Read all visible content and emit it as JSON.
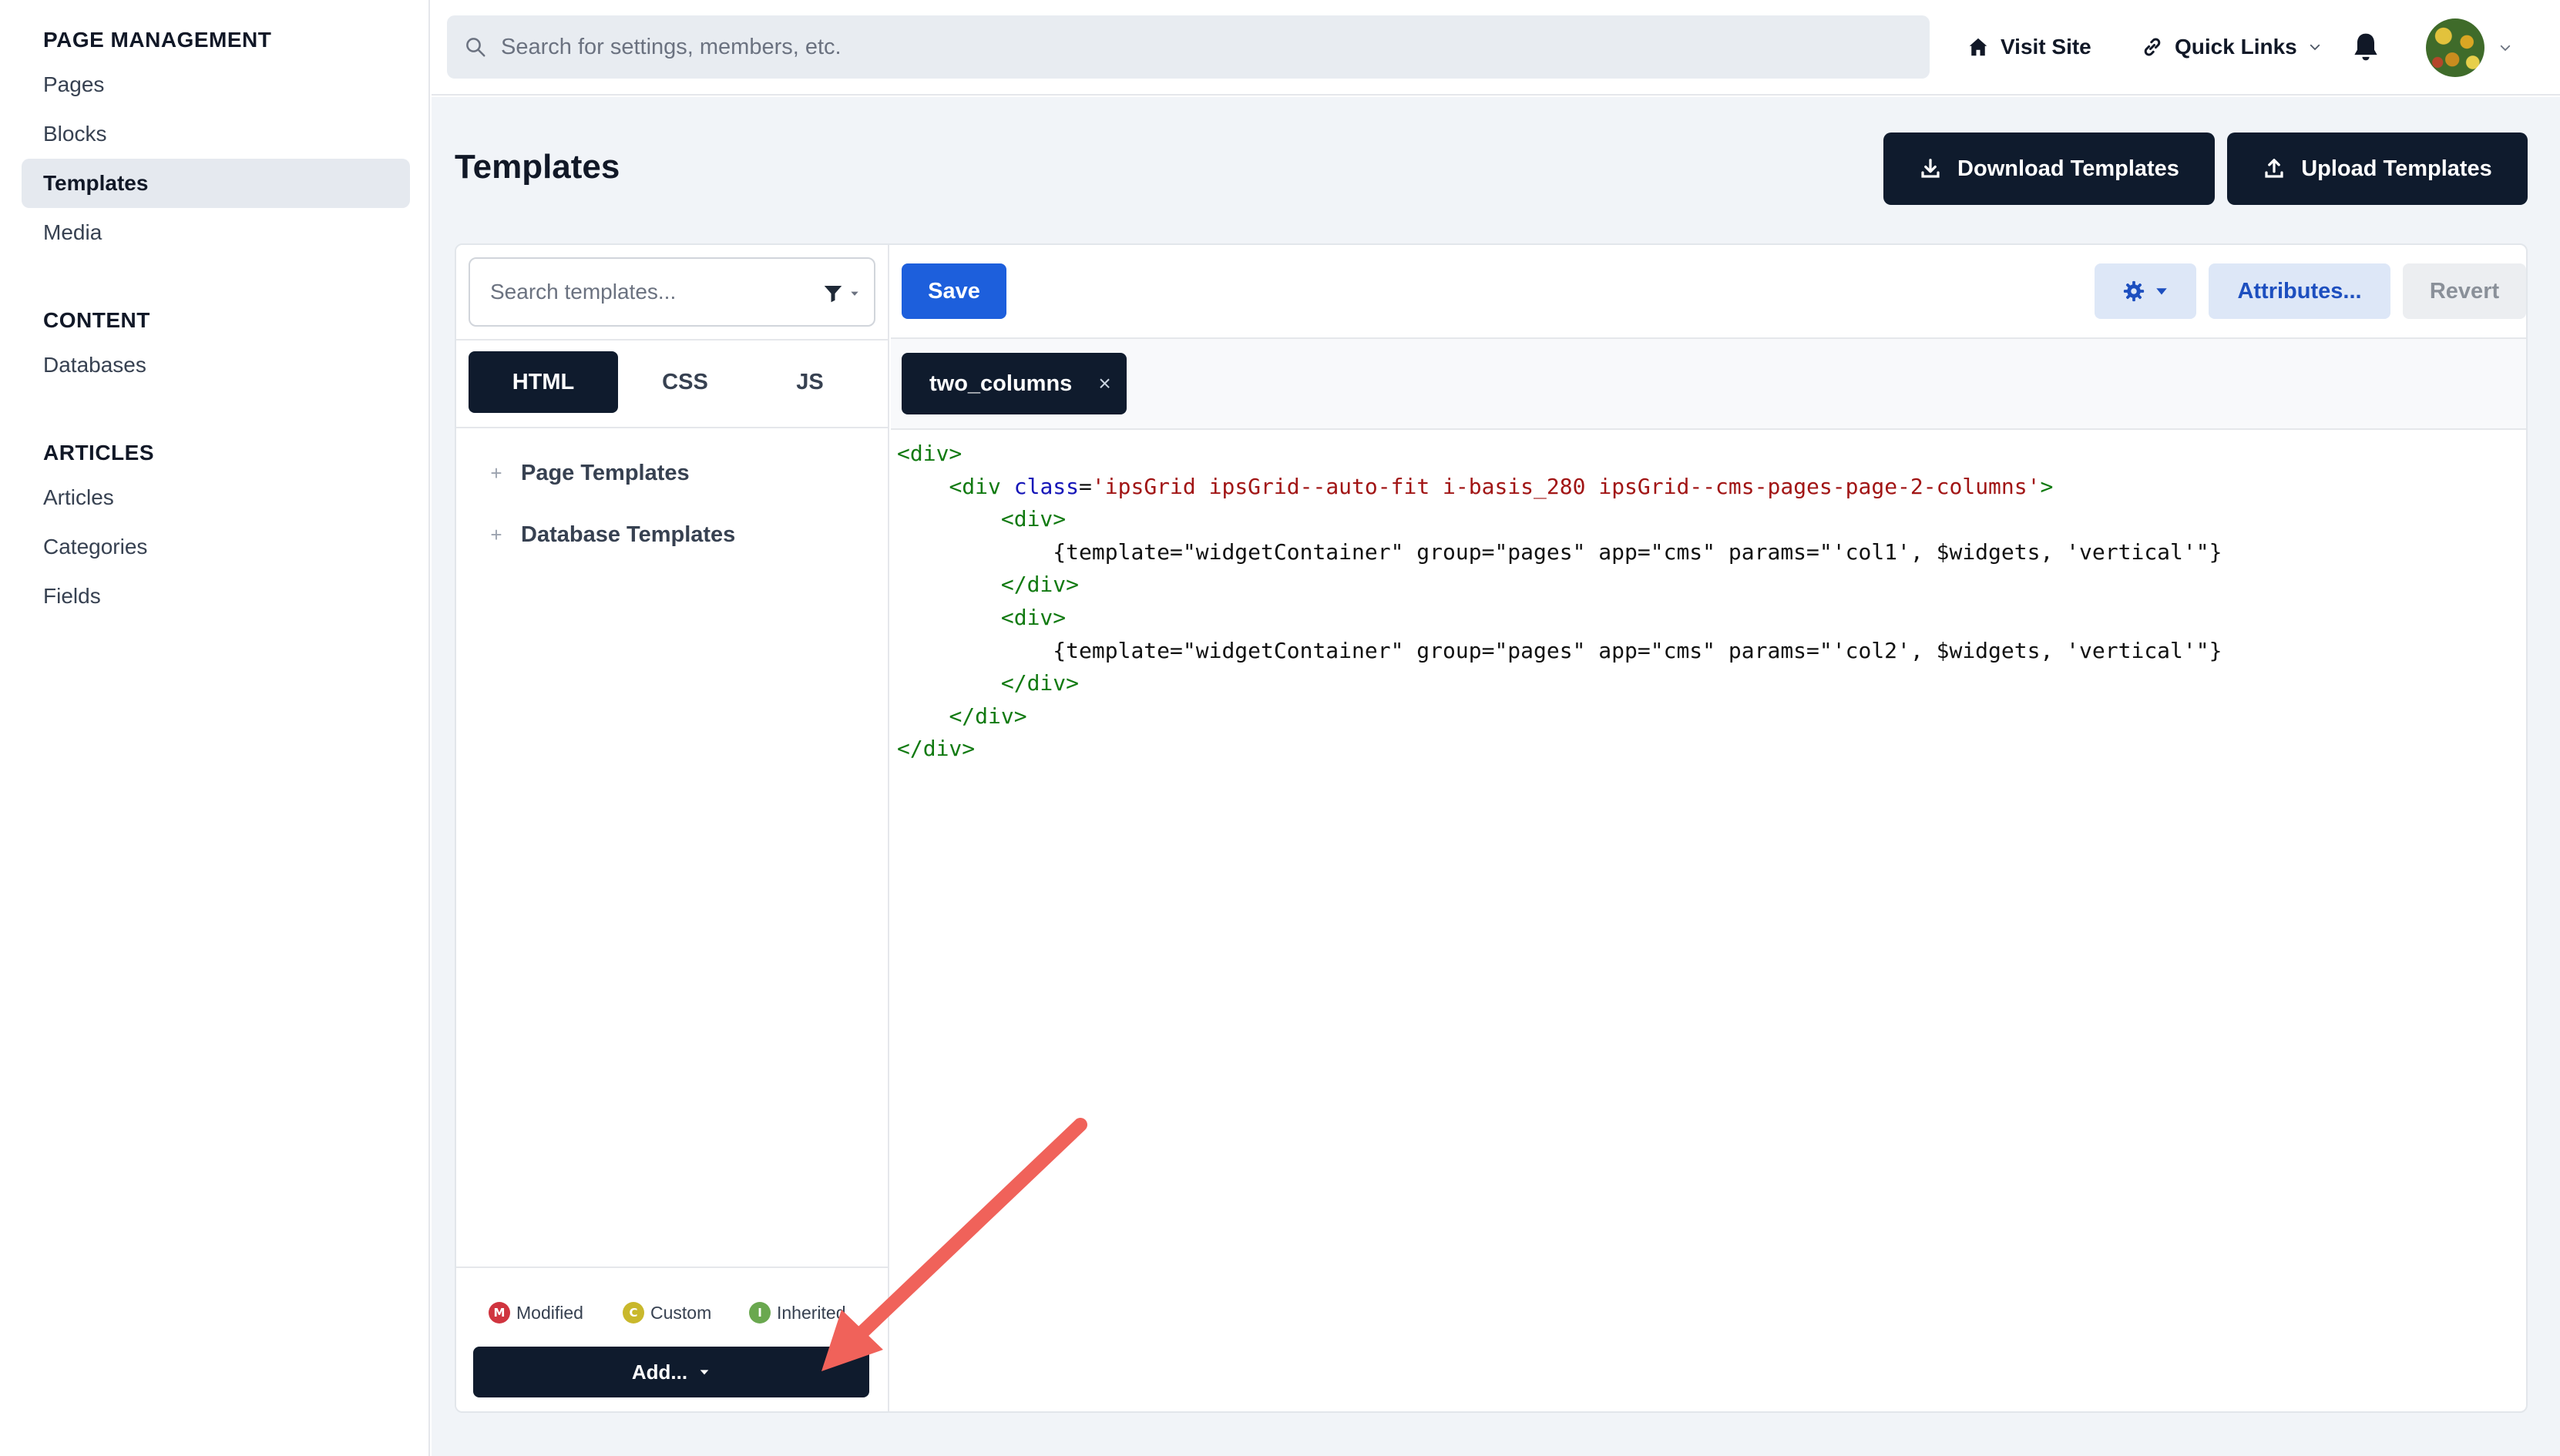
{
  "sidebar": {
    "sections": [
      {
        "heading": "PAGE MANAGEMENT",
        "items": [
          {
            "label": "Pages"
          },
          {
            "label": "Blocks"
          },
          {
            "label": "Templates"
          },
          {
            "label": "Media"
          }
        ]
      },
      {
        "heading": "CONTENT",
        "items": [
          {
            "label": "Databases"
          }
        ]
      },
      {
        "heading": "ARTICLES",
        "items": [
          {
            "label": "Articles"
          },
          {
            "label": "Categories"
          },
          {
            "label": "Fields"
          }
        ]
      }
    ]
  },
  "topbar": {
    "search_placeholder": "Search for settings, members, etc.",
    "visit_site": "Visit Site",
    "quick_links": "Quick Links"
  },
  "page": {
    "title": "Templates",
    "download_label": "Download Templates",
    "upload_label": "Upload Templates"
  },
  "editor": {
    "template_search_placeholder": "Search templates...",
    "lang_tabs": [
      "HTML",
      "CSS",
      "JS"
    ],
    "active_lang_tab": "HTML",
    "tree": [
      "Page Templates",
      "Database Templates"
    ],
    "legend": [
      {
        "letter": "M",
        "label": "Modified",
        "color": "#d0343f"
      },
      {
        "letter": "C",
        "label": "Custom",
        "color": "#c9b82c"
      },
      {
        "letter": "I",
        "label": "Inherited",
        "color": "#6aa84f"
      }
    ],
    "add_label": "Add...",
    "save_label": "Save",
    "attributes_label": "Attributes...",
    "revert_label": "Revert",
    "open_tab": "two_columns",
    "code_lines": [
      [
        [
          "tag",
          "<div>"
        ]
      ],
      [
        [
          "pad",
          "    "
        ],
        [
          "tag",
          "<div "
        ],
        [
          "attr",
          "class"
        ],
        [
          "plain",
          "="
        ],
        [
          "str",
          "'ipsGrid ipsGrid--auto-fit i-basis_280 ipsGrid--cms-pages-page-2-columns'"
        ],
        [
          "tag",
          ">"
        ]
      ],
      [
        [
          "pad",
          "        "
        ],
        [
          "tag",
          "<div>"
        ]
      ],
      [
        [
          "pad",
          "            "
        ],
        [
          "plain",
          "{template=\"widgetContainer\" group=\"pages\" app=\"cms\" params=\"'col1', $widgets, 'vertical'\"}"
        ]
      ],
      [
        [
          "pad",
          "        "
        ],
        [
          "tag",
          "</div>"
        ]
      ],
      [
        [
          "pad",
          "        "
        ],
        [
          "tag",
          "<div>"
        ]
      ],
      [
        [
          "pad",
          "            "
        ],
        [
          "plain",
          "{template=\"widgetContainer\" group=\"pages\" app=\"cms\" params=\"'col2', $widgets, 'vertical'\"}"
        ]
      ],
      [
        [
          "pad",
          "        "
        ],
        [
          "tag",
          "</div>"
        ]
      ],
      [
        [
          "pad",
          "    "
        ],
        [
          "tag",
          "</div>"
        ]
      ],
      [
        [
          "tag",
          "</div>"
        ]
      ]
    ]
  },
  "annotation": {
    "arrow_color": "#f0625a"
  }
}
